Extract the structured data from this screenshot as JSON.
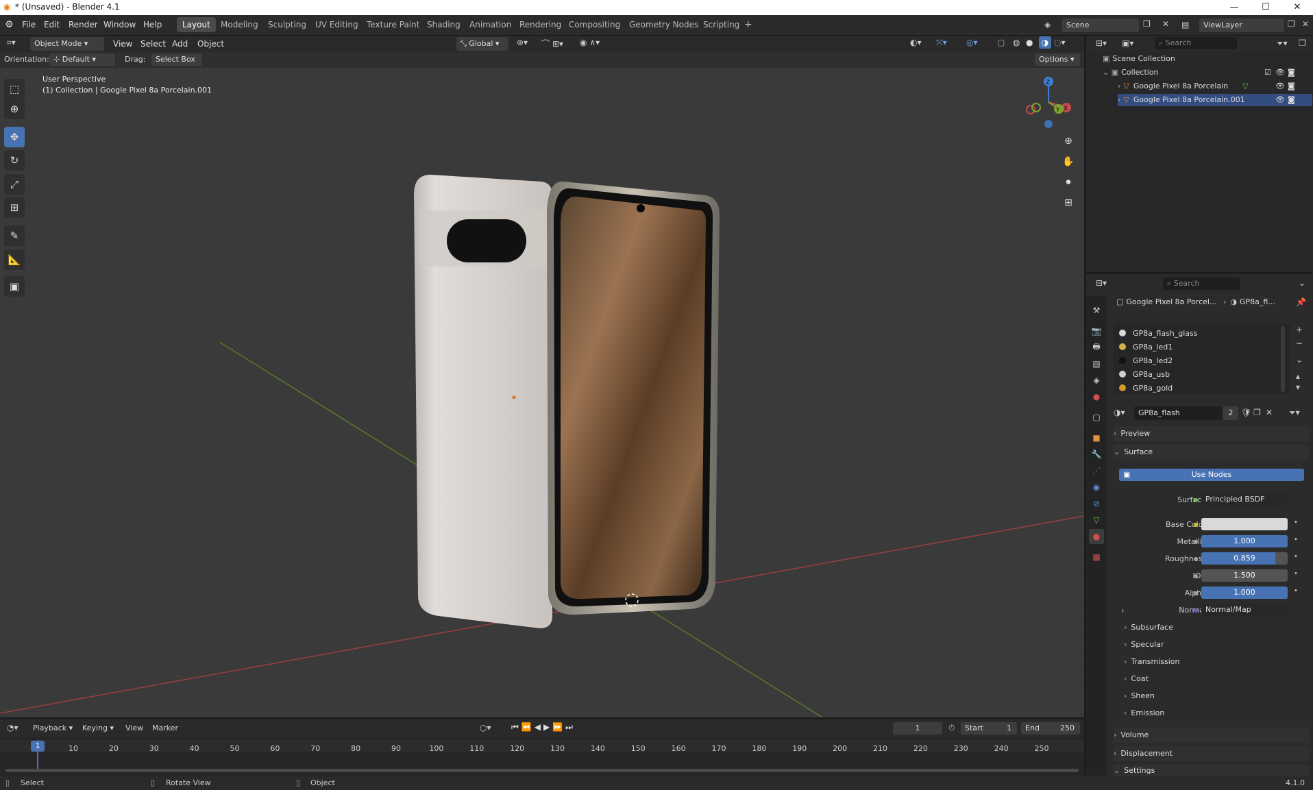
{
  "window": {
    "title": "* (Unsaved) - Blender 4.1"
  },
  "menu": [
    "File",
    "Edit",
    "Render",
    "Window",
    "Help"
  ],
  "workspaces": [
    "Layout",
    "Modeling",
    "Sculpting",
    "UV Editing",
    "Texture Paint",
    "Shading",
    "Animation",
    "Rendering",
    "Compositing",
    "Geometry Nodes",
    "Scripting"
  ],
  "active_workspace": "Layout",
  "scene": {
    "name": "Scene",
    "view_layer": "ViewLayer"
  },
  "viewport_header": {
    "mode": "Object Mode",
    "view": "View",
    "select": "Select",
    "add": "Add",
    "object": "Object",
    "transform": "Global",
    "orientation_label": "Orientation:",
    "orientation_value": "Default",
    "drag_label": "Drag:",
    "drag_value": "Select Box",
    "options": "Options"
  },
  "viewport": {
    "perspective": "User Perspective",
    "collection_info": "(1) Collection | Google Pixel 8a Porcelain.001"
  },
  "gizmo": {
    "x": "X",
    "y": "Y",
    "z": "Z"
  },
  "outliner": {
    "search_placeholder": "Search",
    "root": "Scene Collection",
    "collection": "Collection",
    "items": [
      "Google Pixel 8a Porcelain",
      "Google Pixel 8a Porcelain.001"
    ]
  },
  "properties": {
    "search_placeholder": "Search",
    "breadcrumb_object": "Google Pixel 8a Porcel...",
    "breadcrumb_material": "GP8a_fl...",
    "material_slots": [
      {
        "name": "GP8a_flash_glass",
        "color": "#d8d8d8"
      },
      {
        "name": "GP8a_led1",
        "color": "#d6b04a"
      },
      {
        "name": "GP8a_led2",
        "color": "#111111"
      },
      {
        "name": "GP8a_usb",
        "color": "#cfcfcf"
      },
      {
        "name": "GP8a_gold",
        "color": "#d49a2a"
      }
    ],
    "material_name": "GP8a_flash",
    "user_count": "2",
    "preview": "Preview",
    "surface": "Surface",
    "use_nodes": "Use Nodes",
    "surface_label": "Surface",
    "surface_shader": "Principled BSDF",
    "base_color_label": "Base Color",
    "base_color": "#d9d9d9",
    "metallic_label": "Metallic",
    "metallic": "1.000",
    "metallic_fraction": 1.0,
    "roughness_label": "Roughness",
    "roughness": "0.859",
    "roughness_fraction": 0.859,
    "ior_label": "IOR",
    "ior": "1.500",
    "ior_fraction": 0,
    "alpha_label": "Alpha",
    "alpha": "1.000",
    "alpha_fraction": 1.0,
    "normal_label": "Normal",
    "normal_value": "Normal/Map",
    "subpanels": [
      "Subsurface",
      "Specular",
      "Transmission",
      "Coat",
      "Sheen",
      "Emission"
    ],
    "volume": "Volume",
    "displacement": "Displacement",
    "settings": "Settings"
  },
  "timeline": {
    "playback": "Playback",
    "keying": "Keying",
    "view": "View",
    "marker": "Marker",
    "current_frame": "1",
    "start_label": "Start",
    "start": "1",
    "end_label": "End",
    "end": "250",
    "current_marker": "1",
    "ticks": [
      "10",
      "20",
      "30",
      "40",
      "50",
      "60",
      "70",
      "80",
      "90",
      "100",
      "110",
      "120",
      "130",
      "140",
      "150",
      "160",
      "170",
      "180",
      "190",
      "200",
      "210",
      "220",
      "230",
      "240",
      "250"
    ]
  },
  "status": {
    "select": "Select",
    "rotate": "Rotate View",
    "object": "Object",
    "version": "4.1.0"
  },
  "colors": {
    "accent": "#4772b3",
    "viewport_bg": "#3a3a3a",
    "x_axis": "#c84b4b",
    "y_axis": "#7ea32e",
    "z_axis": "#3d7fd6"
  }
}
